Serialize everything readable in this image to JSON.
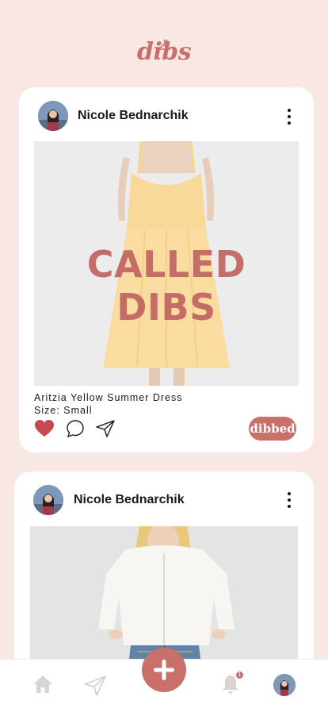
{
  "app": {
    "logo_text": "dibs",
    "accent_color": "#c9706a"
  },
  "posts": [
    {
      "username": "Nicole Bednarchik",
      "overlay_text": "CALLED DIBS",
      "item_title": "Aritzia Yellow Summer Dress",
      "item_size": "Size: Small",
      "liked": true,
      "dibbed_label": "dibbed",
      "menu_icon": "kebab-menu-icon"
    },
    {
      "username": "Nicole Bednarchik",
      "menu_icon": "kebab-menu-icon"
    }
  ],
  "tabbar": {
    "items": [
      "home-icon",
      "send-icon",
      "add-icon",
      "bell-icon",
      "profile-avatar"
    ],
    "notification_count": "1"
  }
}
